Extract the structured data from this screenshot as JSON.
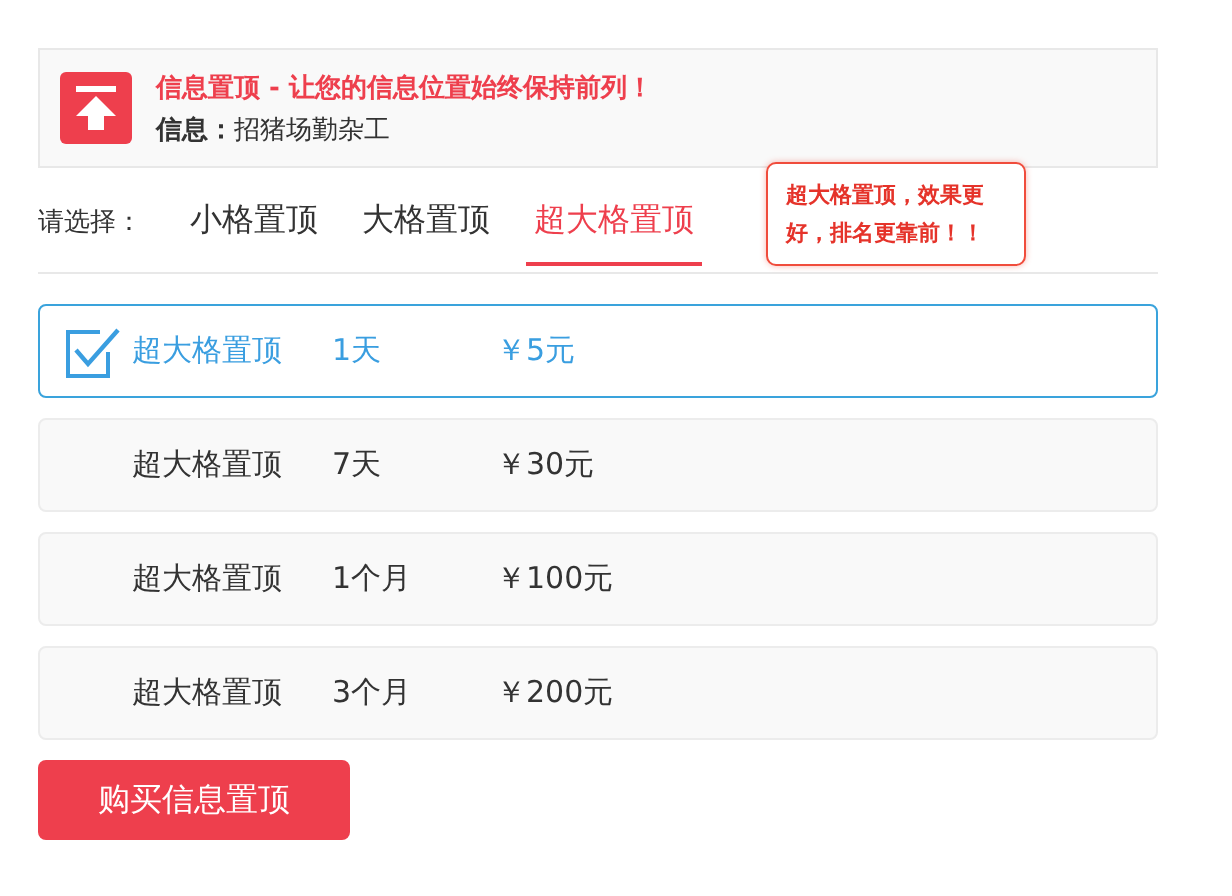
{
  "banner": {
    "title": "信息置顶 - 让您的信息位置始终保持前列！",
    "info": "**信息：**招猪场勤杂工"
  },
  "tabs_label": "请选择：",
  "tabs": [
    {
      "label": "小格置顶",
      "selected": false
    },
    {
      "label": "大格置顶",
      "selected": false
    },
    {
      "label": "超大格置顶",
      "selected": true
    }
  ],
  "tooltip": "超大格置顶，效果更好，排名更靠前！！",
  "options": [
    {
      "name": "超大格置顶",
      "duration": "1天",
      "price": "￥5元",
      "selected": true
    },
    {
      "name": "超大格置顶",
      "duration": "7天",
      "price": "￥30元",
      "selected": false
    },
    {
      "name": "超大格置顶",
      "duration": "1个月",
      "price": "￥100元",
      "selected": false
    },
    {
      "name": "超大格置顶",
      "duration": "3个月",
      "price": "￥200元",
      "selected": false
    }
  ],
  "buy_button": "购买信息置顶"
}
